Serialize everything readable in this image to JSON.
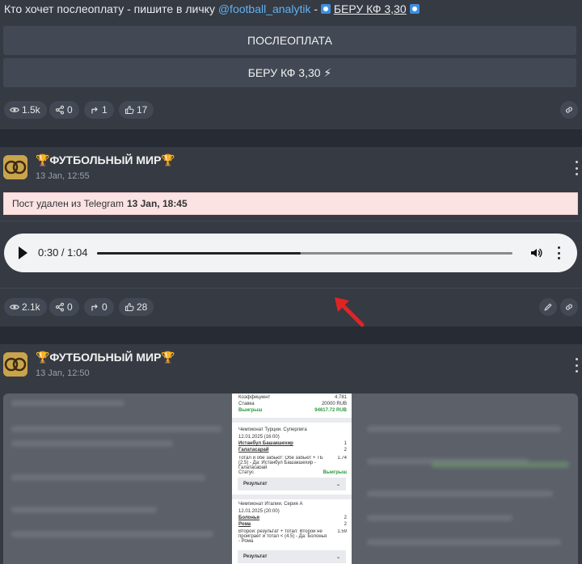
{
  "post1": {
    "text_prefix": "Кто хочет послеоплату - пишите в личку ",
    "text_link": "@football_analytik",
    "text_sep": " - ",
    "text_link2": "БЕРУ КФ 3,30",
    "buttons": [
      "ПОСЛЕОПЛАТА",
      "БЕРУ КФ 3,30 ⚡"
    ],
    "stats": {
      "views": "1.5k",
      "shares": "0",
      "forwards": "1",
      "likes": "17"
    }
  },
  "post2": {
    "channel": "🏆ФУТБОЛЬНЫЙ МИР🏆",
    "date": "13 Jan, 12:55",
    "deleted_text": "Пост удален из Telegram",
    "deleted_date": "13 Jan, 18:45",
    "audio": {
      "time": "0:30 / 1:04",
      "progress": 0.49
    },
    "stats": {
      "views": "2.1k",
      "shares": "0",
      "forwards": "0",
      "likes": "28"
    }
  },
  "post3": {
    "channel": "🏆ФУТБОЛЬНЫЙ МИР🏆",
    "date": "13 Jan, 12:50",
    "ticket": {
      "coef_label": "Коэффициент",
      "coef_value": "4.781",
      "stake_label": "Ставка",
      "stake_value": "20000 RUB",
      "won_label": "Выигрыш",
      "won_value": "94617.72 RUB",
      "m1_league": "Чемпионат Турции. Суперлига",
      "m1_date": "12.01.2025 (16:00)",
      "m1_team1": "Истанбул Башакшехир",
      "m1_score1": "1",
      "m1_team2": "Галатасарай",
      "m1_score2": "2",
      "m1_bet": "Тотал и обе забьют: Обе забьют + ТБ (2.5) - Да: Истанбул Башакшехир - Галатасарай",
      "m1_odds": "1.74",
      "status_label": "Статус",
      "status_value": "Выигрыш",
      "result_label": "Результат",
      "m2_league": "Чемпионат Италии. Серия А",
      "m2_date": "12.01.2025 (20:00)",
      "m2_team1": "Болонья",
      "m2_score1": "2",
      "m2_team2": "Рома",
      "m2_score2": "2",
      "m2_bet": "Второй: результат + тотал: Второй не проиграет и тотал < (4.5) - Да: Болонья - Рома",
      "m2_odds": "1.59"
    }
  },
  "colors": {
    "bg": "#272b33",
    "card": "#353a43",
    "button": "#434954",
    "link": "#62b1f0",
    "banner": "#fbe3e4",
    "arrow": "#e02424"
  }
}
